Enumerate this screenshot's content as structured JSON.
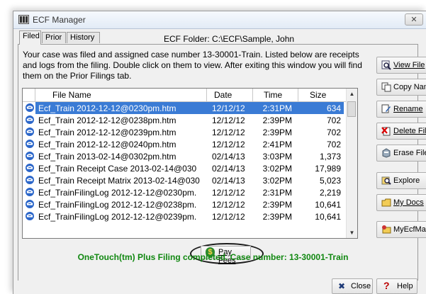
{
  "window": {
    "title": "ECF Manager",
    "close_glyph": "✕"
  },
  "tabs": [
    {
      "label": "Filed",
      "active": true
    },
    {
      "label": "Prior",
      "active": false
    },
    {
      "label": "History",
      "active": false
    }
  ],
  "folder": {
    "label": "ECF Folder:",
    "path": "C:\\ECF\\Sample, John"
  },
  "description": "Your case was filed and assigned case number 13-30001-Train. Listed below are receipts and logs from the filing. Double click on them to view. After exiting this window you will find them on the Prior Filings tab.",
  "table": {
    "columns": [
      "File Name",
      "Date",
      "Time",
      "Size"
    ],
    "rows": [
      {
        "name": "Ecf_Train 2012-12-12@0230pm.htm",
        "date": "12/12/12",
        "time": "2:31PM",
        "size": "634",
        "selected": true
      },
      {
        "name": "Ecf_Train 2012-12-12@0238pm.htm",
        "date": "12/12/12",
        "time": "2:39PM",
        "size": "702"
      },
      {
        "name": "Ecf_Train 2012-12-12@0239pm.htm",
        "date": "12/12/12",
        "time": "2:39PM",
        "size": "702"
      },
      {
        "name": "Ecf_Train 2012-12-12@0240pm.htm",
        "date": "12/12/12",
        "time": "2:41PM",
        "size": "702"
      },
      {
        "name": "Ecf_Train 2013-02-14@0302pm.htm",
        "date": "02/14/13",
        "time": "3:03PM",
        "size": "1,373"
      },
      {
        "name": "Ecf_Train Receipt Case 2013-02-14@030",
        "date": "02/14/13",
        "time": "3:02PM",
        "size": "17,989"
      },
      {
        "name": "Ecf_Train Receipt Matrix 2013-02-14@030",
        "date": "02/14/13",
        "time": "3:02PM",
        "size": "5,023"
      },
      {
        "name": "Ecf_TrainFilingLog 2012-12-12@0230pm.",
        "date": "12/12/12",
        "time": "2:31PM",
        "size": "2,219"
      },
      {
        "name": "Ecf_TrainFilingLog 2012-12-12@0238pm.",
        "date": "12/12/12",
        "time": "2:39PM",
        "size": "10,641"
      },
      {
        "name": "Ecf_TrainFilingLog 2012-12-12@0239pm.",
        "date": "12/12/12",
        "time": "2:39PM",
        "size": "10,641"
      }
    ]
  },
  "side_buttons": [
    {
      "name": "view-file-button",
      "icon": "magnifier-icon",
      "label": "View File"
    },
    {
      "name": "copy-name-button",
      "icon": "copy-icon",
      "label": "Copy Name"
    },
    {
      "name": "rename-button",
      "icon": "rename-icon",
      "label": "Rename"
    },
    {
      "name": "delete-file-button",
      "icon": "delete-icon",
      "label": "Delete File"
    },
    {
      "name": "erase-files-button",
      "icon": "eraser-icon",
      "label": "Erase Files"
    },
    {
      "name": "explore-button",
      "icon": "explore-icon",
      "label": "Explore"
    },
    {
      "name": "my-docs-button",
      "icon": "folder-icon",
      "label": "My Docs"
    },
    {
      "name": "my-ecfmail-button",
      "icon": "mail-icon",
      "label": "MyEcfMail"
    }
  ],
  "pay_fees": {
    "label": "Pay Fees",
    "icon_glyph": "$"
  },
  "status_message": "OneTouch(tm) Plus Filing completed. Case number: 13-30001-Train",
  "footer": {
    "close_label": "Close",
    "close_glyph": "✖",
    "help_label": "Help",
    "help_glyph": "?"
  },
  "colors": {
    "selection": "#3a7bd5",
    "status_text": "#118811",
    "title_text": "#333333"
  }
}
